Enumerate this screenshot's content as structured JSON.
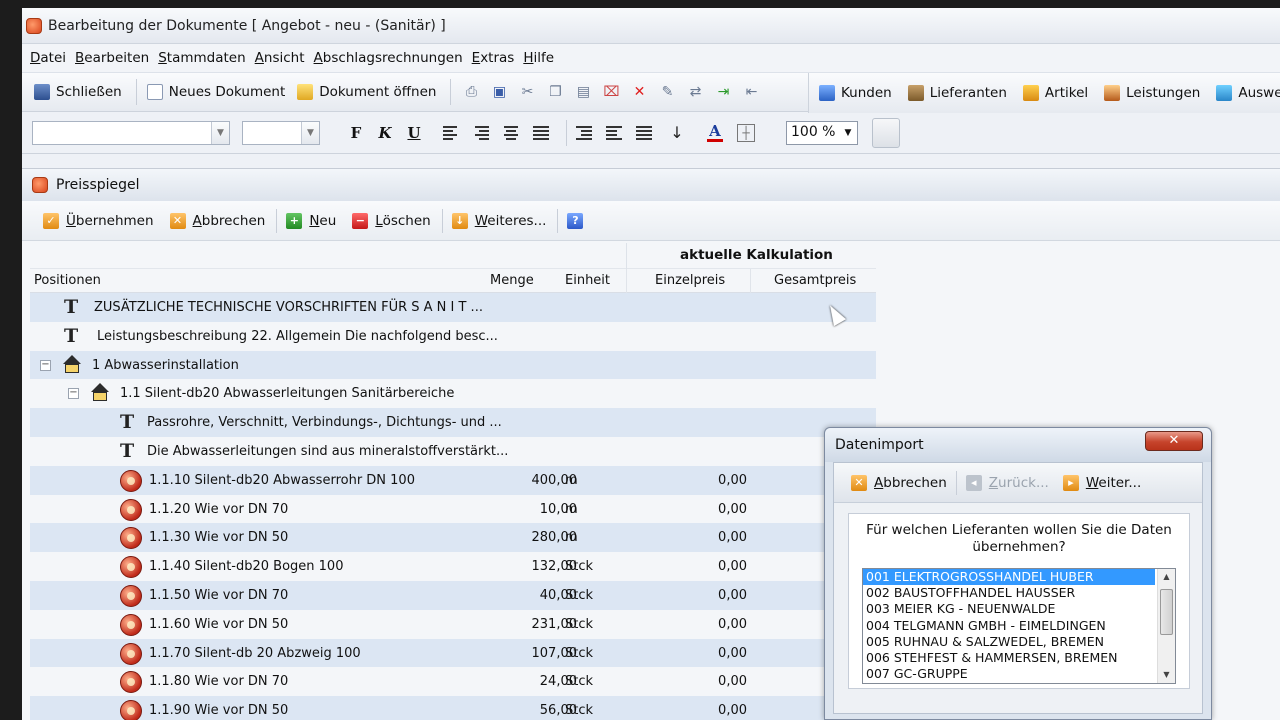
{
  "window": {
    "title": "Bearbeitung der Dokumente [ Angebot - neu - (Sanitär) ]"
  },
  "menu": [
    "Datei",
    "Bearbeiten",
    "Stammdaten",
    "Ansicht",
    "Abschlagsrechnungen",
    "Extras",
    "Hilfe"
  ],
  "toolbar": {
    "close_label": "Schließen",
    "new_doc_label": "Neues Dokument",
    "open_doc_label": "Dokument öffnen",
    "customers_label": "Kunden",
    "suppliers_label": "Lieferanten",
    "articles_label": "Artikel",
    "services_label": "Leistungen",
    "evaluation_label": "Auswertun"
  },
  "format": {
    "bold": "F",
    "italic": "K",
    "underline": "U",
    "font_color": "A",
    "zoom": "100 %"
  },
  "child": {
    "title": "Preisspiegel",
    "toolbar": {
      "apply": "Übernehmen",
      "cancel": "Abbrechen",
      "new": "Neu",
      "delete": "Löschen",
      "more": "Weiteres...",
      "help": "?"
    },
    "header_group": "aktuelle Kalkulation",
    "columns": {
      "positions": "Positionen",
      "menge": "Menge",
      "einheit": "Einheit",
      "einzelpreis": "Einzelpreis",
      "gesamtpreis": "Gesamtpreis"
    },
    "rows": [
      {
        "text": "ZUSÄTZLICHE TECHNISCHE VORSCHRIFTEN FÜR     S A N I T ...",
        "icon": "text-icon"
      },
      {
        "text": "Leistungsbeschreibung  22.   Allgemein  Die nachfolgend besc...",
        "icon": "text-icon"
      },
      {
        "text": "1 Abwasserinstallation",
        "icon": "house-icon"
      },
      {
        "text": "1.1 Silent-db20 Abwasserleitungen             Sanitärbereiche",
        "icon": "house-icon"
      },
      {
        "text": "Passrohre, Verschnitt, Verbindungs-, Dichtungs- und ...",
        "icon": "text-icon"
      },
      {
        "text": "Die Abwasserleitungen sind aus mineralstoffverstärkt...",
        "icon": "text-icon"
      },
      {
        "text": "1.1.10 Silent-db20 Abwasserrohr DN 100",
        "menge": "400,00",
        "einheit": "m",
        "ep": "0,00",
        "icon": "position-icon"
      },
      {
        "text": "1.1.20 Wie vor DN 70",
        "menge": "10,00",
        "einheit": "m",
        "ep": "0,00",
        "icon": "position-icon"
      },
      {
        "text": "1.1.30 Wie vor DN 50",
        "menge": "280,00",
        "einheit": "m",
        "ep": "0,00",
        "icon": "position-icon"
      },
      {
        "text": "1.1.40 Silent-db20 Bogen 100",
        "menge": "132,00",
        "einheit": "Stck",
        "ep": "0,00",
        "icon": "position-icon"
      },
      {
        "text": "1.1.50 Wie vor DN 70",
        "menge": "40,00",
        "einheit": "Stck",
        "ep": "0,00",
        "icon": "position-icon"
      },
      {
        "text": "1.1.60 Wie vor DN 50",
        "menge": "231,00",
        "einheit": "Stck",
        "ep": "0,00",
        "icon": "position-icon"
      },
      {
        "text": "1.1.70 Silent-db 20 Abzweig 100",
        "menge": "107,00",
        "einheit": "Stck",
        "ep": "0,00",
        "icon": "position-icon"
      },
      {
        "text": "1.1.80 Wie vor DN 70",
        "menge": "24,00",
        "einheit": "Stck",
        "ep": "0,00",
        "icon": "position-icon"
      },
      {
        "text": "1.1.90 Wie vor DN 50",
        "menge": "56,00",
        "einheit": "Stck",
        "ep": "0,00",
        "icon": "position-icon"
      }
    ]
  },
  "dialog": {
    "title": "Datenimport",
    "close": "✕",
    "toolbar": {
      "cancel": "Abbrechen",
      "back": "Zurück...",
      "next": "Weiter..."
    },
    "question": "Für welchen Lieferanten wollen Sie die Daten übernehmen?",
    "suppliers": [
      "001 ELEKTROGROSSHANDEL HUBER",
      "002 BAUSTOFFHANDEL HAUSSER",
      "003 MEIER KG - NEUENWALDE",
      "004 TELGMANN GMBH - EIMELDINGEN",
      "005 RUHNAU & SALZWEDEL, BREMEN",
      "006 STEHFEST & HAMMERSEN, BREMEN",
      "007 GC-GRUPPE"
    ],
    "selected_index": 0
  }
}
